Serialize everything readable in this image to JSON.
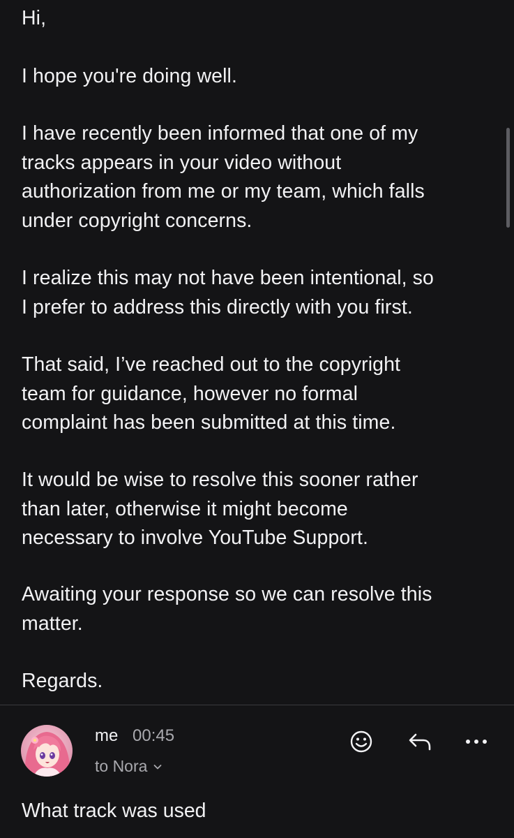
{
  "email": {
    "greeting": "Hi,",
    "hope": "I hope you're doing well.",
    "informed": "I have recently been informed that one of my\ntracks appears in your video without\nauthorization from me or my team, which falls\nunder copyright concerns.",
    "realize": "I realize this may not have been intentional, so\nI prefer to address this directly with you first.",
    "that_said": "That said, I’ve reached out to the copyright\nteam for guidance, however no formal\ncomplaint has been submitted at this time.",
    "wise": "It would be wise to resolve this sooner rather\nthan later, otherwise it might become\nnecessary to involve YouTube Support.",
    "awaiting": "Awaiting your response so we can resolve this\nmatter.",
    "regards": "Regards."
  },
  "reply_message": {
    "sender": "me",
    "time": "00:45",
    "recipient_label": "to Nora",
    "body": "What track was used",
    "avatar_icon": "anime-avatar",
    "actions": [
      "smiley-reaction-icon",
      "reply-icon",
      "more-options-icon"
    ]
  },
  "colors": {
    "background": "#141416",
    "text_primary": "#f2f2f4",
    "text_secondary": "#a9a9ae"
  }
}
